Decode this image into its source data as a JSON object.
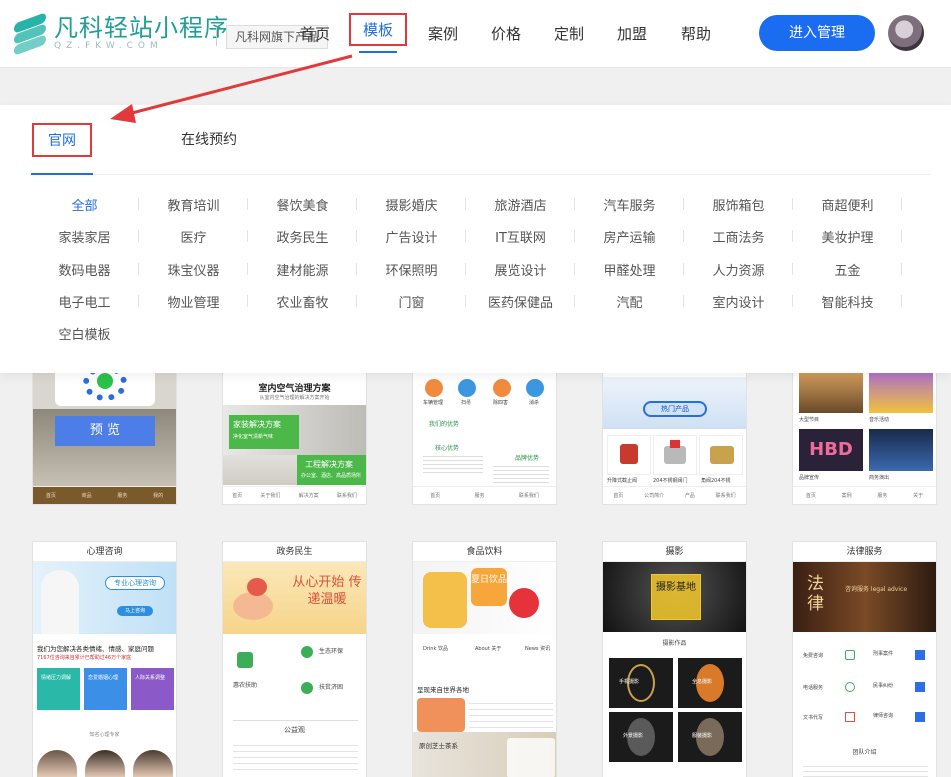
{
  "header": {
    "logo_title": "凡科轻站小程序",
    "logo_sub": "QZ.FKW.COM",
    "badge": "凡科网旗下产品",
    "nav": [
      {
        "label": "首页"
      },
      {
        "label": "模板"
      },
      {
        "label": "案例"
      },
      {
        "label": "价格"
      },
      {
        "label": "定制"
      },
      {
        "label": "加盟"
      },
      {
        "label": "帮助"
      }
    ],
    "cta": "进入管理"
  },
  "panel": {
    "tabs": [
      "官网",
      "在线预约"
    ],
    "categories": [
      "全部",
      "教育培训",
      "餐饮美食",
      "摄影婚庆",
      "旅游酒店",
      "汽车服务",
      "服饰箱包",
      "商超便利",
      "家装家居",
      "医疗",
      "政务民生",
      "广告设计",
      "IT互联网",
      "房产运输",
      "工商法务",
      "美妆护理",
      "数码电器",
      "珠宝仪器",
      "建材能源",
      "环保照明",
      "展览设计",
      "甲醛处理",
      "人力资源",
      "五金",
      "电子电工",
      "物业管理",
      "农业畜牧",
      "门窗",
      "医药保健品",
      "汽配",
      "室内设计",
      "智能科技",
      "空白模板"
    ]
  },
  "cards_row1": {
    "preview_button": "预 览",
    "c2_title": "室内空气治理方案",
    "c2_sub": "从室内空气治理的解决方案开始",
    "c2_a": "家装解决方案",
    "c2_a_sub": "净化室气清新气味",
    "c2_b": "工程解决方案",
    "c2_b_sub": "办公室、酒店、高品质场所",
    "c3_icons": [
      "车辆管理",
      "扫帚",
      "除四害",
      "消杀"
    ],
    "c3_section": "我们的优势",
    "c3_left": "核心优势",
    "c3_right": "品牌优势",
    "c4_btn": "热门产品",
    "c4_caps": [
      "升降式截止阀",
      "204不锈钢阀门",
      "角阀204不锈"
    ],
    "c5_caps": [
      "大型节目",
      "音乐活动",
      "品牌宣传",
      "商务演出"
    ],
    "c5_hbd": "HBD"
  },
  "cards_row2": [
    {
      "title": "心理咨询",
      "hero": "专业心理咨询",
      "hero_btn": "马上咨询",
      "headline": "我们为您解决各类情绪、情感、家庭问题",
      "sub": "7167位咨询来自累计已帮助过46万个家庭",
      "tiles": [
        "情绪压力调解",
        "恋爱婚姻心理",
        "人际关系调整"
      ],
      "section": "知名心理专家"
    },
    {
      "title": "政务民生",
      "hero": "从心开始 传递温暖",
      "items": [
        "生态环保",
        "惠农扶助",
        "扶贫济困"
      ],
      "section": "公益观"
    },
    {
      "title": "食品饮料",
      "hero": "夏日饮品",
      "links": [
        "Drink 饮品",
        "About 关于",
        "News 资讯"
      ],
      "headline": "呈现来自世界各地",
      "promo": "原创芝士茶系"
    },
    {
      "title": "摄影",
      "hero": "摄影基地",
      "section": "摄影作品",
      "tiles": [
        "手机摄影",
        "全息摄影",
        "外景摄影",
        "服装摄影"
      ]
    },
    {
      "title": "法律服务",
      "hero": "法律",
      "hero_sub": "咨询服务 legal advice",
      "rows": [
        "免费咨询",
        "电话服务",
        "文书代写",
        "刑事案件",
        "民事纠纷",
        "律师咨询"
      ],
      "section": "团队介绍"
    }
  ],
  "colors": {
    "accent": "#1a6cf0",
    "highlight": "#e23a3a",
    "brand": "#1f9f96"
  }
}
